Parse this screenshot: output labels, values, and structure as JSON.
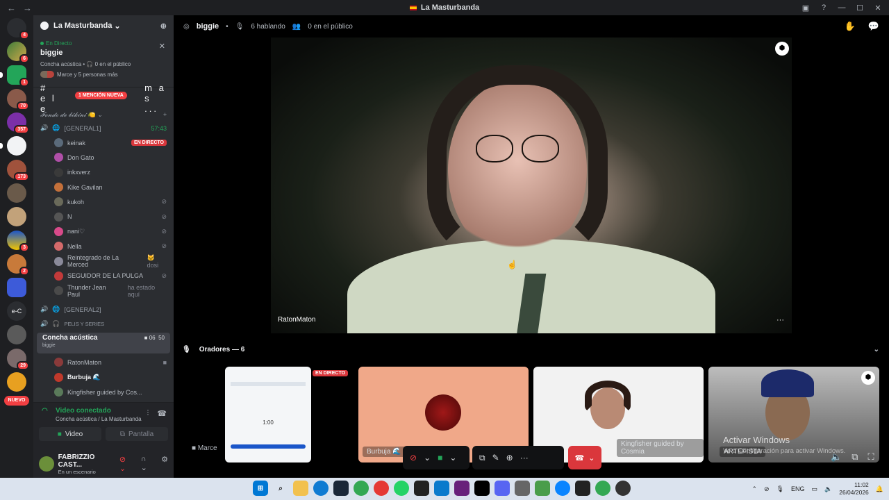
{
  "window": {
    "title": "La Masturbanda"
  },
  "guilds": {
    "badges": [
      "4",
      "6",
      "1",
      "70",
      "357",
      "173",
      "3",
      "2",
      "29"
    ],
    "new_label": "NUEVO",
    "ec_label": "e-C"
  },
  "server": {
    "name": "La Masturbanda"
  },
  "live_card": {
    "tag": "En Directo",
    "title": "biggie",
    "subtitle": "Concha acústica • 🎧 0 en el público",
    "people": "Marce y 5 personas más"
  },
  "text_channel": {
    "name": "# e l e",
    "tail": "m a s ...",
    "mention": "1 MENCIÓN NUEVA"
  },
  "category": {
    "name": "𝓕𝓸𝓷𝓭𝓸 𝓭𝓮 𝓫𝓲𝓴𝓲𝓷𝓲 🍋"
  },
  "voice_channels": [
    {
      "name": "[GENERAL1]",
      "timer": "57:43"
    },
    {
      "name": "[GENERAL2]"
    },
    {
      "name": "PELIS Y SERIES"
    }
  ],
  "general1_users": [
    {
      "name": "keinak",
      "status": "EN DIRECTO"
    },
    {
      "name": "Don Gato"
    },
    {
      "name": "inkxverz"
    },
    {
      "name": "Kike Gavilan"
    },
    {
      "name": "kukoh"
    },
    {
      "name": "N"
    },
    {
      "name": "nani♡"
    },
    {
      "name": "Nella"
    },
    {
      "name": "Reintegrado de La Merced",
      "extra": "🐱 dosi"
    },
    {
      "name": "SEGUIDOR DE LA PULGA"
    },
    {
      "name": "Thunder Jean Paul",
      "extra": "ha estado aquí"
    }
  ],
  "stage_channel": {
    "name": "Concha acústica",
    "sub": "biggie",
    "meta_a": "06",
    "meta_b": "50",
    "users": [
      "RatonMaton",
      "Burbuja 🌊",
      "Kingfisher guided by Cos..."
    ]
  },
  "voice_panel": {
    "status": "Video conectado",
    "sub": "Concha acústica / La Masturbanda",
    "video_btn": "Video",
    "screen_btn": "Pantalla"
  },
  "user_panel": {
    "name": "FABRIZZIO CAST...",
    "status": "En un escenario"
  },
  "stage_header": {
    "name": "biggie",
    "speaking": "6 hablando",
    "audience": "0 en el público"
  },
  "main_video": {
    "name": "RatonMaton"
  },
  "speakers": {
    "label": "Oradores — 6"
  },
  "tiles": {
    "live_badge": "EN DIRECTO",
    "marce": "Marce",
    "burbuja": "Burbuja 🌊",
    "cosmia": "Kingfisher guided by Cosmia",
    "last": "ARTEFISTA",
    "screen_time": "1:00"
  },
  "watermark": {
    "line1": "Activar Windows",
    "line2": "Ve a Configuración para activar Windows."
  },
  "taskbar": {
    "lang": "ENG",
    "time": "11:02",
    "date": "26/04/2026"
  }
}
